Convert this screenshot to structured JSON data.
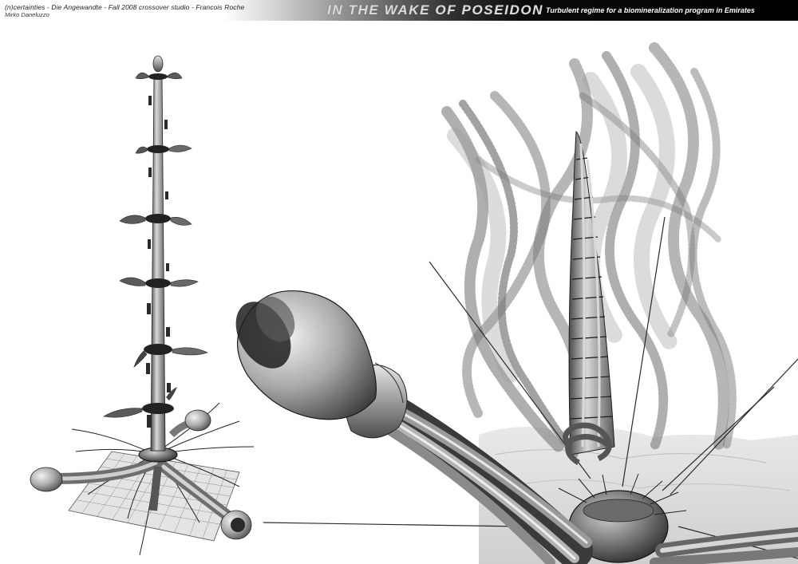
{
  "header": {
    "studio_line": "(n)certainties - Die Angewandte - Fall 2008 crossover studio - Francois Roche",
    "author": "Mirko Daneluzzo",
    "title": "IN THE WAKE OF POSEIDON",
    "subtitle": "Turbulent regime for a  biomineralization program in Emirates"
  },
  "colors": {
    "header_dark": "#000000",
    "render_metal": "#8c8c8c",
    "particle_cloud": "#7a7a7a"
  }
}
